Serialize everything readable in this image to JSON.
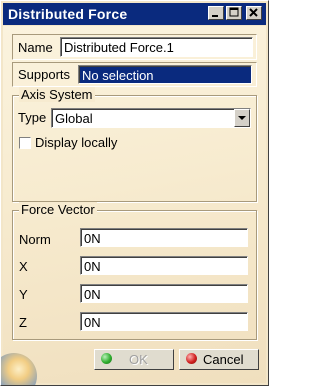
{
  "window": {
    "title": "Distributed Force",
    "buttons": {
      "minimize": "minimize-icon",
      "maximize": "maximize-icon",
      "close": "close-icon"
    }
  },
  "name_row": {
    "label": "Name",
    "value": "Distributed Force.1"
  },
  "supports_row": {
    "label": "Supports",
    "value": "No selection"
  },
  "axis_system": {
    "title": "Axis System",
    "type_label": "Type",
    "type_value": "Global",
    "display_locally_label": "Display locally",
    "display_locally_checked": false
  },
  "force_vector": {
    "title": "Force Vector",
    "rows": [
      {
        "label": "Norm",
        "value": "0N"
      },
      {
        "label": "X",
        "value": "0N"
      },
      {
        "label": "Y",
        "value": "0N"
      },
      {
        "label": "Z",
        "value": "0N"
      }
    ]
  },
  "footer": {
    "ok_label": "OK",
    "ok_enabled": false,
    "cancel_label": "Cancel"
  },
  "colors": {
    "titlebar": "#0a2a7e",
    "panel_bg": "#f7ebcf",
    "selection": "#0a2a7e",
    "ok_dot": "#2fae2f",
    "cancel_dot": "#d02020"
  }
}
